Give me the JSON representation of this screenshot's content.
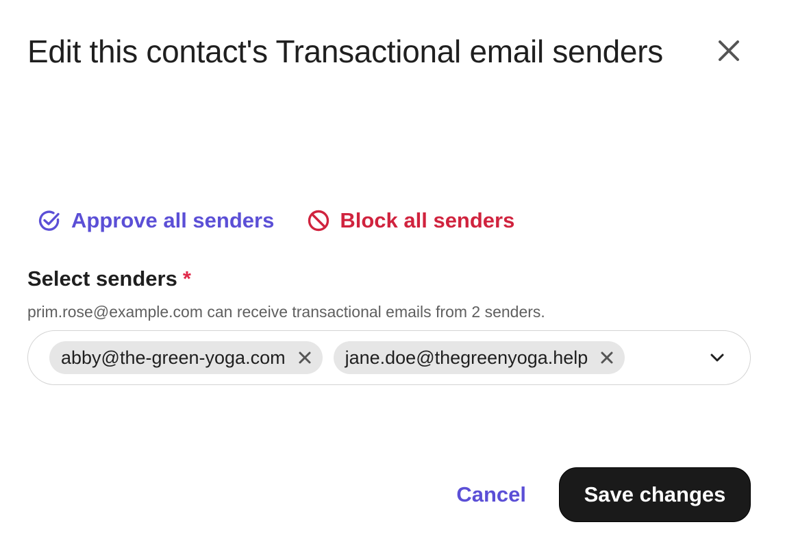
{
  "dialog": {
    "title": "Edit this contact's Transactional email senders",
    "close_icon": "close-icon"
  },
  "bulk_actions": {
    "approve_label": "Approve all senders",
    "approve_icon": "check-circle-icon",
    "approve_color": "#5b4fd6",
    "block_label": "Block all senders",
    "block_icon": "block-icon",
    "block_color": "#d0233e"
  },
  "field": {
    "label": "Select senders",
    "required_marker": "*",
    "help_text": "prim.rose@example.com can receive transactional emails from 2 senders."
  },
  "selected_senders": [
    {
      "email": "abby@the-green-yoga.com"
    },
    {
      "email": "jane.doe@thegreenyoga.help"
    }
  ],
  "footer": {
    "cancel_label": "Cancel",
    "save_label": "Save changes"
  }
}
